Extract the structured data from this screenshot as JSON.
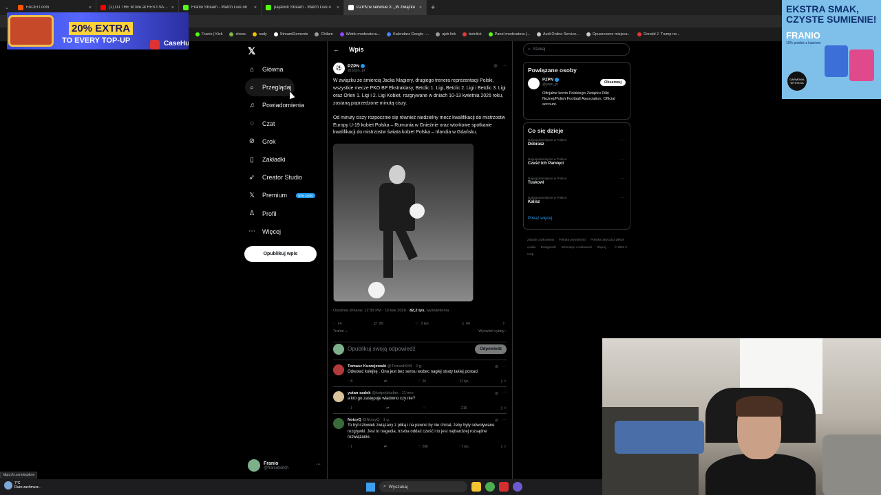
{
  "browser": {
    "tabs": [
      {
        "title": "FACEIT.com",
        "color": "#ff5500"
      },
      {
        "title": "(1) DJ THE M live at FESTIVALA",
        "color": "#ff0000"
      },
      {
        "title": "Franio Stream - Watch Live on",
        "color": "#53fc18"
      },
      {
        "title": "pajalock Stream - Watch Live o",
        "color": "#53fc18"
      },
      {
        "title": "PZPN w serwisie X: „W związku",
        "color": "#ffffff"
      }
    ],
    "bookmarks": [
      {
        "label": "Franio | Kick",
        "color": "#53fc18"
      },
      {
        "label": "chess",
        "color": "#81b64c"
      },
      {
        "label": "nudy",
        "color": "#f0c000"
      },
      {
        "label": "StreamElements",
        "color": "#ffffff"
      },
      {
        "label": "Chilam",
        "color": "#9a9a9a"
      },
      {
        "label": "Widok moderatora...",
        "color": "#9146ff"
      },
      {
        "label": "Kalendarz Google -...",
        "color": "#4285f4"
      },
      {
        "label": "ujeb link",
        "color": "#9a9a9a"
      },
      {
        "label": "betclick",
        "color": "#e53935"
      },
      {
        "label": "Panel moderatora |...",
        "color": "#53fc18"
      },
      {
        "label": "Audi Online Service...",
        "color": "#cccccc"
      },
      {
        "label": "Opuszczone miejsca...",
        "color": "#cccccc"
      },
      {
        "label": "Donald J. Trump ne...",
        "color": "#e53935"
      }
    ],
    "status_url": "https://x.com/explore"
  },
  "promo_left": {
    "headline": "20% EXTRA",
    "sub": "TO EVERY TOP-UP",
    "brand": "CaseHug"
  },
  "promo_right": {
    "headline": "EKSTRA SMAK, CZYSTE SUMIENIE!",
    "brand": "FRANIO",
    "sub": "10% polskie z kasiowe",
    "badge": "DARMOWA WYSYŁKA"
  },
  "nav": {
    "items": [
      {
        "label": "Główna",
        "icon": "home-icon",
        "glyph": "⌂"
      },
      {
        "label": "Przeglądaj",
        "icon": "search-icon",
        "glyph": "⌕"
      },
      {
        "label": "Powiadomienia",
        "icon": "bell-icon",
        "glyph": "♫"
      },
      {
        "label": "Czat",
        "icon": "chat-icon",
        "glyph": "◌"
      },
      {
        "label": "Grok",
        "icon": "grok-icon",
        "glyph": "⊘"
      },
      {
        "label": "Zakładki",
        "icon": "bookmark-icon",
        "glyph": "▯"
      },
      {
        "label": "Creator Studio",
        "icon": "rocket-icon",
        "glyph": "➶"
      },
      {
        "label": "Premium",
        "icon": "x-premium-icon",
        "glyph": "𝕏"
      },
      {
        "label": "Profil",
        "icon": "profile-icon",
        "glyph": "♙"
      },
      {
        "label": "Więcej",
        "icon": "more-icon",
        "glyph": "⋯"
      }
    ],
    "premium_badge": "50% zniżki",
    "post_button": "Opublikuj wpis",
    "account_name": "Franio",
    "account_handle": "@franiotwitch"
  },
  "main": {
    "header": "Wpis",
    "post": {
      "author": "PZPN",
      "handle": "@pzpn_pl",
      "paragraph1": "W związku ze śmiercią Jacka Magiery, drugiego trenera reprezentacji Polski, wszystkie mecze PKO BP Ekstraklasy, Betclic 1. Ligi, Betclic 2. Ligi i Betclic 3. Ligi oraz Orlen 1. Ligi i 2. Ligi Kobiet, rozgrywane w dniach 10-13 kwietnia 2026 roku, zostaną poprzedzone minutą ciszy.",
      "paragraph2": "Od minuty ciszy rozpocznie się również niedzielny mecz kwalifikacji do mistrzostw Europy U-19 kobiet Polska – Rumunia w Gnieźnie oraz wtorkowe spotkanie kwalifikacji do mistrzostw świata kobiet Polska – Irlandia w Gdańsku.",
      "meta_prefix": "Ostatnia zmiana: 12:39 PM · 10 kwi 2026 · ",
      "views": "82,2 tys.",
      "views_suffix": " wyświetlenia",
      "stats": {
        "replies": "14",
        "reposts": "99",
        "likes": "3 tys.",
        "bookmarks": "40"
      },
      "sort_label": "Trafne",
      "quotes_label": "Wyświetl cytaty"
    },
    "reply_box": {
      "placeholder": "Opublikuj swoją odpowiedź",
      "button": "Odpowiedz"
    },
    "replies": [
      {
        "name": "Tomasz Kurzejewski",
        "handle": "@Tomash944",
        "time": "2 g.",
        "text": "Odwołać kolejkę . Ona jest bez sensu wobec nagłej straty takiej postaci",
        "replies": "8",
        "likes": "26",
        "views": "11 tys.",
        "color": "#b33a3a"
      },
      {
        "name": "yutan sadek",
        "handle": "@kotpolskafan",
        "time": "11 min",
        "text": "a kto go zastępuje wiadomo czy nie?",
        "replies": "1",
        "likes": "",
        "views": "215",
        "color": "#d8c39a"
      },
      {
        "name": "NoizyQ",
        "handle": "@NoizyQ",
        "time": "1 g.",
        "text": "To był człowiek związany z piłką i na pewno by nie chciał, żeby były odwoływane rozgrywki. Jest to tragedia, trzeba oddać cześć i to jest najbardziej rozsądne rozwiązanie.",
        "replies": "1",
        "likes": "206",
        "views": "7 tys.",
        "color": "#3a6b3a"
      }
    ]
  },
  "right": {
    "search_placeholder": "Szukaj",
    "related_title": "Powiązane osoby",
    "related": {
      "name": "PZPN",
      "handle": "@pzpn_pl",
      "follow": "Obserwuj",
      "bio": "Oficjalne konto Polskiego Związku Piłki Nożnej/Polish Football Association. Official account."
    },
    "trending_title": "Co się dzieje",
    "trends": [
      {
        "context": "Najpopularniejsze w Polsce",
        "name": "Dobrasz"
      },
      {
        "context": "Najpopularniejsze w Polsce",
        "name": "Cześć Ich Pamięci"
      },
      {
        "context": "Najpopularniejsze w Polsce",
        "name": "Tuskowi"
      },
      {
        "context": "Najpopularniejsze w Polsce",
        "name": "Kalisz"
      }
    ],
    "show_more": "Pokaż więcej",
    "footer": [
      "Zasady użytkowania",
      "Polityka prywatności",
      "Polityka dotycząca plików cookie",
      "Dostępność",
      "Informacje o reklamach",
      "Więcej ···",
      "© 2026 X Corp."
    ]
  },
  "taskbar": {
    "temp": "7°C",
    "weather": "Duże zachmurz...",
    "search": "Wyszukaj"
  }
}
